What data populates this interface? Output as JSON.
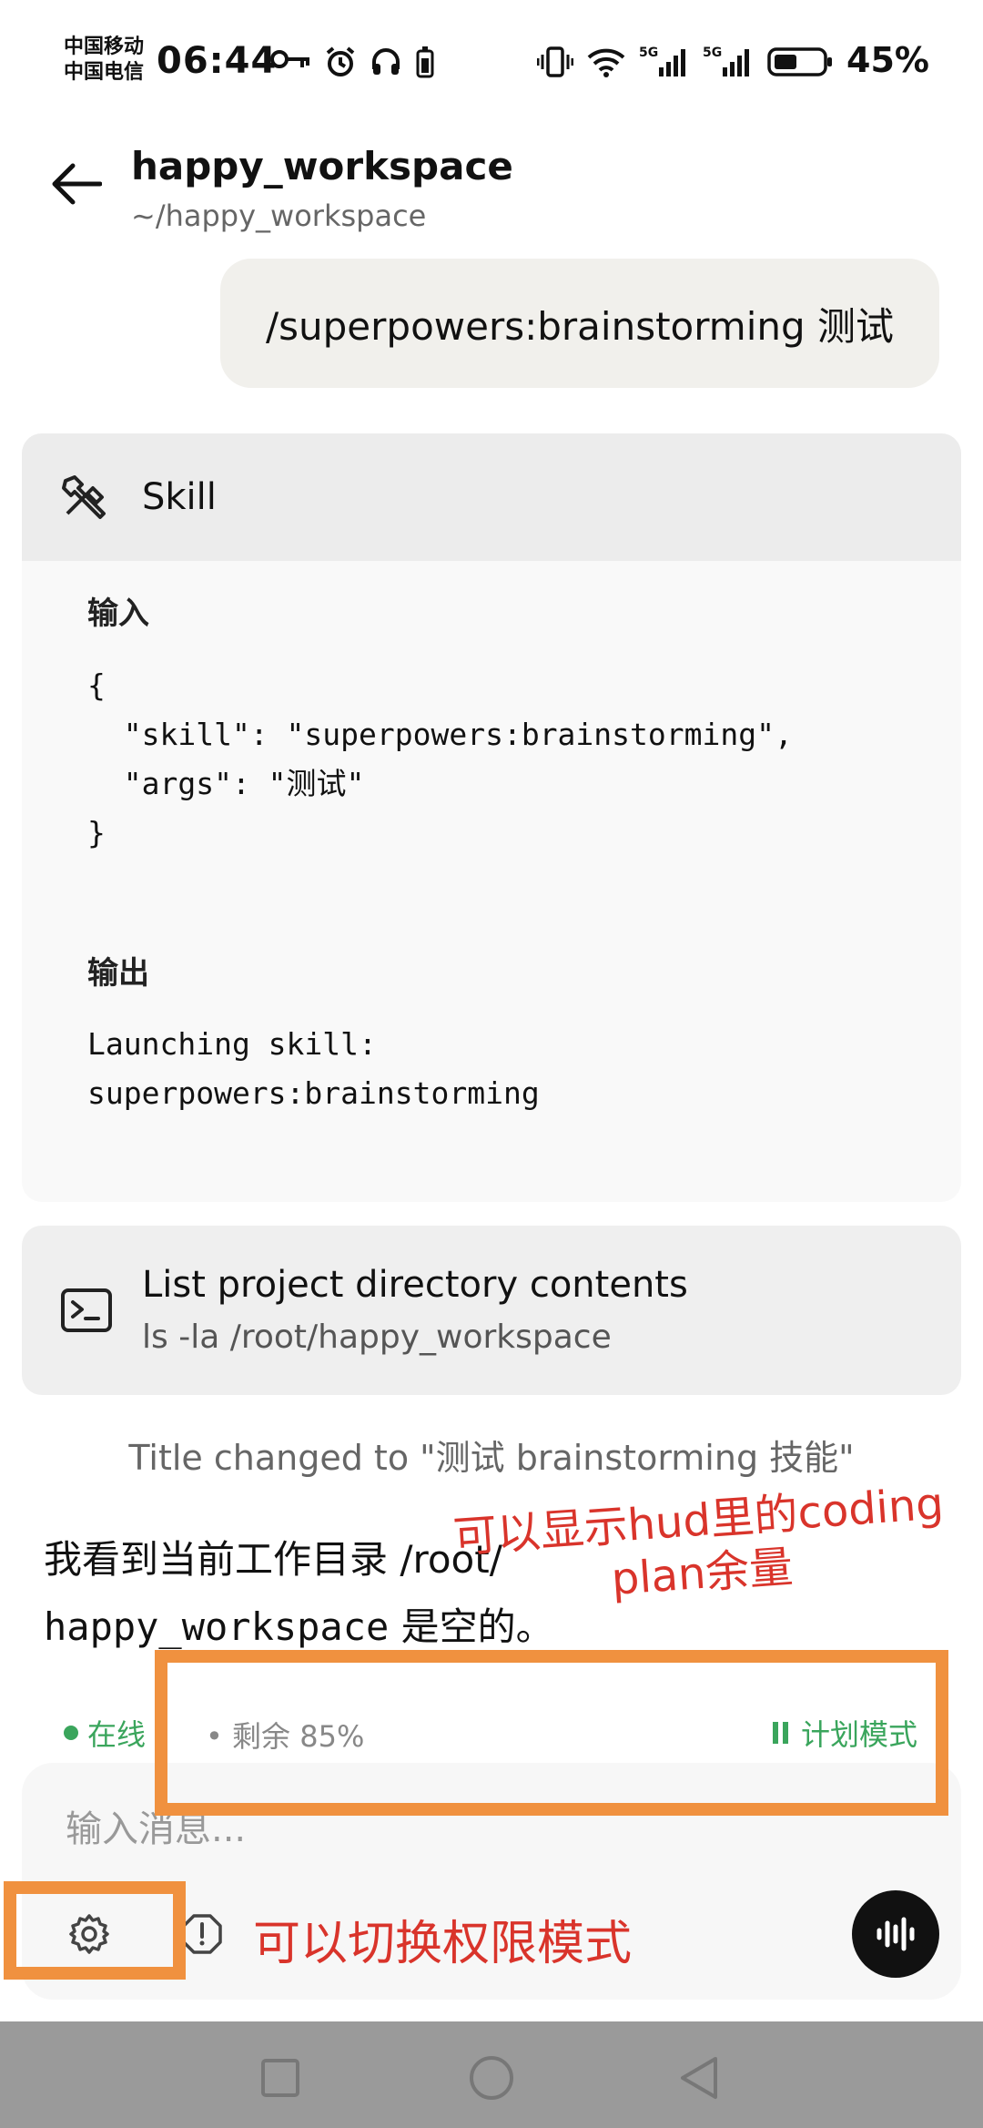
{
  "status_bar": {
    "carrier_1": "中国移动",
    "carrier_2": "中国电信",
    "time": "06:44",
    "battery": "45%"
  },
  "header": {
    "title": "happy_workspace",
    "path": "~/happy_workspace"
  },
  "user_message": "/superpowers:brainstorming 测试",
  "skill_card": {
    "name": "Skill",
    "input_label": "输入",
    "input_code": "{\n  \"skill\": \"superpowers:brainstorming\",\n  \"args\": \"测试\"\n}",
    "output_label": "输出",
    "output_code": "Launching skill:\nsuperpowers:brainstorming"
  },
  "command_card": {
    "title": "List project directory contents",
    "command": "ls -la /root/happy_workspace"
  },
  "system_note": "Title changed to \"测试 brainstorming 技能\"",
  "assistant": {
    "text_1": "我看到当前工作目录 /root/",
    "text_2": "happy_workspace",
    "text_3": " 是空的。"
  },
  "status": {
    "online": "在线",
    "remaining": "• 剩余 85%",
    "mode": "计划模式"
  },
  "composer": {
    "placeholder": "输入消息..."
  },
  "annotations": {
    "hud_note_1": "可以显示hud里的coding",
    "hud_note_2": "plan余量",
    "permission_note": "可以切换权限模式"
  },
  "colors": {
    "annotation_box": "#f0913f",
    "annotation_text": "#d9342b",
    "online_green": "#3aa55c"
  }
}
